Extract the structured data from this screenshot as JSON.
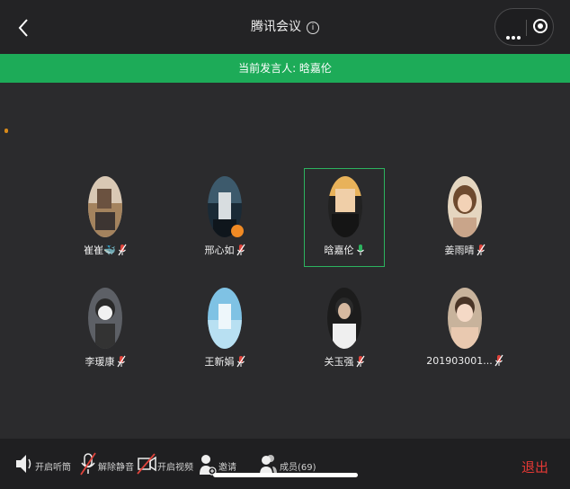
{
  "header": {
    "title": "腾讯会议",
    "info_glyph": "i"
  },
  "banner": {
    "text": "当前发言人: 晗嘉伦"
  },
  "participants": [
    {
      "name": "崔崔🐳",
      "mic": "muted"
    },
    {
      "name": "邢心如",
      "mic": "muted",
      "badge": true
    },
    {
      "name": "晗嘉伦",
      "mic": "active",
      "speaking": true
    },
    {
      "name": "姜雨晴",
      "mic": "muted"
    },
    {
      "name": "李瑗康",
      "mic": "muted"
    },
    {
      "name": "王新娟",
      "mic": "muted"
    },
    {
      "name": "关玉强",
      "mic": "muted"
    },
    {
      "name": "201903001...",
      "mic": "muted"
    }
  ],
  "toolbar": {
    "speaker_label": "开启听筒",
    "unmute_label": "解除静音",
    "video_label": "开启视频",
    "invite_label": "邀请",
    "members_label": "成员(69)",
    "exit_label": "退出"
  },
  "colors": {
    "accent_green": "#1dab58",
    "exit_red": "#e53935",
    "muted_red": "#e0443c"
  }
}
